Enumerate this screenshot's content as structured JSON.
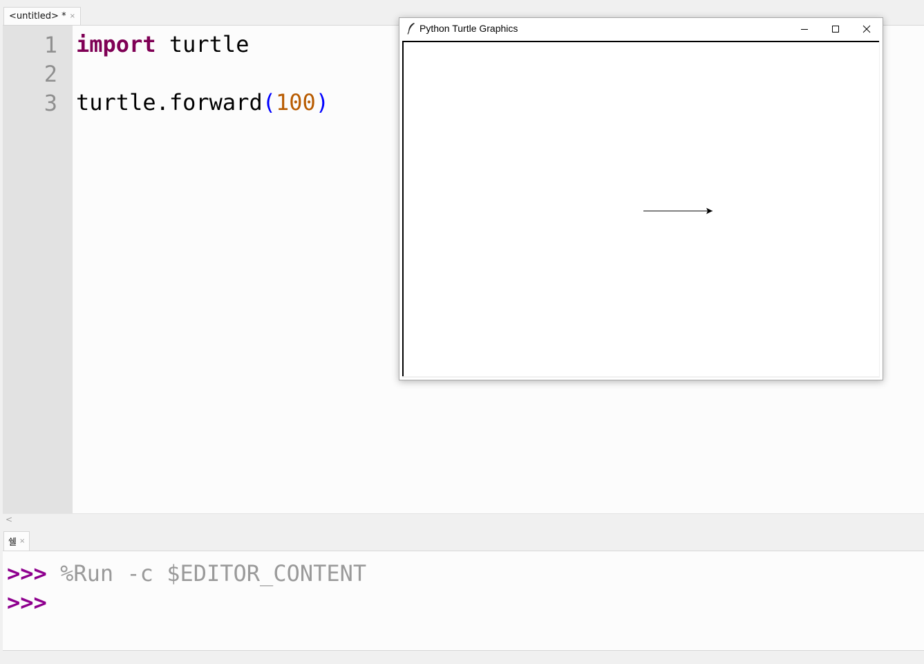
{
  "editor": {
    "tab_title": "<untitled> *",
    "tab_close": "×",
    "line_numbers": [
      "1",
      "2",
      "3"
    ],
    "code": {
      "line1_keyword": "import",
      "line1_rest": " turtle",
      "line3_call": "turtle.forward",
      "line3_open": "(",
      "line3_arg": "100",
      "line3_close": ")"
    },
    "scroll_left_glyph": "<"
  },
  "shell": {
    "tab_title": "쉘",
    "tab_close": "×",
    "lines": [
      {
        "prompt": ">>>",
        "command": " %Run -c $EDITOR_CONTENT"
      },
      {
        "prompt": ">>>",
        "command": ""
      }
    ]
  },
  "turtle_window": {
    "title": "Python Turtle Graphics",
    "icons": {
      "app": "feather-icon",
      "minimize": "minimize-icon",
      "maximize": "maximize-icon",
      "close": "close-icon"
    },
    "forward_distance": 100
  },
  "colors": {
    "keyword": "#7f0055",
    "paren": "#0000ff",
    "number": "#b85b00",
    "prompt": "#8e008e",
    "gutter": "#e2e2e2"
  }
}
